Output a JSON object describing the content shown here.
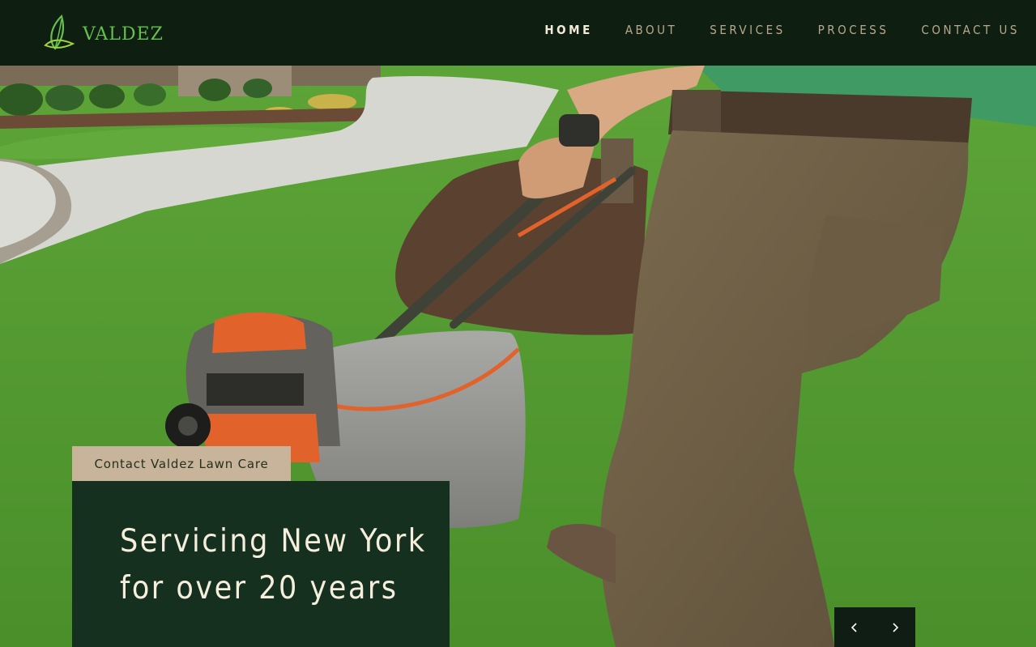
{
  "brand": {
    "name": "VALDEZ",
    "color": "#63c14c"
  },
  "nav": {
    "items": [
      {
        "label": "HOME",
        "active": true
      },
      {
        "label": "ABOUT"
      },
      {
        "label": "SERVICES"
      },
      {
        "label": "PROCESS"
      },
      {
        "label": "CONTACT US"
      }
    ]
  },
  "hero": {
    "tag": "Contact Valdez Lawn Care",
    "headline_line1": "Servicing New York",
    "headline_line2": "for over 20 years",
    "prev_icon": "chevron-left-icon",
    "next_icon": "chevron-right-icon"
  },
  "colors": {
    "header_bg": "#0e1f12",
    "nav_text": "#b8a98c",
    "tag_bg": "#c7b49a",
    "headline_bg": "#163020"
  }
}
